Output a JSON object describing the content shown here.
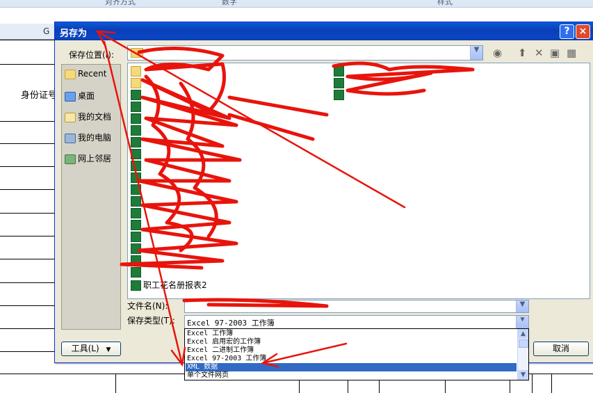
{
  "excel": {
    "ribbon_groups": [
      "对齐方式",
      "数字",
      "样式"
    ],
    "column_header": "G",
    "cell_text": "身份证号"
  },
  "dialog": {
    "title": "另存为",
    "help_label": "?",
    "close_label": "×",
    "save_in_label": "保存位置(I):",
    "save_in_value": "",
    "places": [
      {
        "label": "Recent",
        "icon": "recent-icon"
      },
      {
        "label": "桌面",
        "icon": "desktop-icon"
      },
      {
        "label": "我的文档",
        "icon": "my-documents-icon"
      },
      {
        "label": "我的电脑",
        "icon": "my-computer-icon"
      },
      {
        "label": "网上邻居",
        "icon": "network-icon"
      }
    ],
    "files_col1": [
      {
        "name": "",
        "type": "folder"
      },
      {
        "name": "",
        "type": "folder"
      },
      {
        "name": "",
        "type": "xls"
      },
      {
        "name": "",
        "type": "xls"
      },
      {
        "name": "",
        "type": "xls"
      },
      {
        "name": "",
        "type": "xls"
      },
      {
        "name": "",
        "type": "xls"
      },
      {
        "name": "",
        "type": "xls"
      },
      {
        "name": "",
        "type": "xls"
      },
      {
        "name": "",
        "type": "xls"
      },
      {
        "name": "",
        "type": "xls"
      },
      {
        "name": "",
        "type": "xls"
      },
      {
        "name": "",
        "type": "xls"
      },
      {
        "name": "",
        "type": "xls"
      },
      {
        "name": "",
        "type": "xls"
      },
      {
        "name": "",
        "type": "xls"
      },
      {
        "name": "",
        "type": "xls"
      },
      {
        "name": "",
        "type": "xls"
      },
      {
        "name": "职工花名册报表2",
        "type": "xls"
      }
    ],
    "files_col2": [
      {
        "name": "",
        "type": "xls"
      },
      {
        "name": "",
        "type": "xls"
      },
      {
        "name": "",
        "type": "xls"
      }
    ],
    "file_name_label": "文件名(N):",
    "file_name_value": "",
    "file_type_label": "保存类型(T):",
    "file_type_value": "Excel 97-2003 工作簿",
    "file_type_options": [
      "Excel 工作簿",
      "Excel 启用宏的工作簿",
      "Excel 二进制工作簿",
      "Excel 97-2003 工作簿",
      "XML 数据",
      "单个文件网页"
    ],
    "file_type_selected": "XML 数据",
    "tools_label": "工具(L)",
    "cancel_label": "取消"
  }
}
